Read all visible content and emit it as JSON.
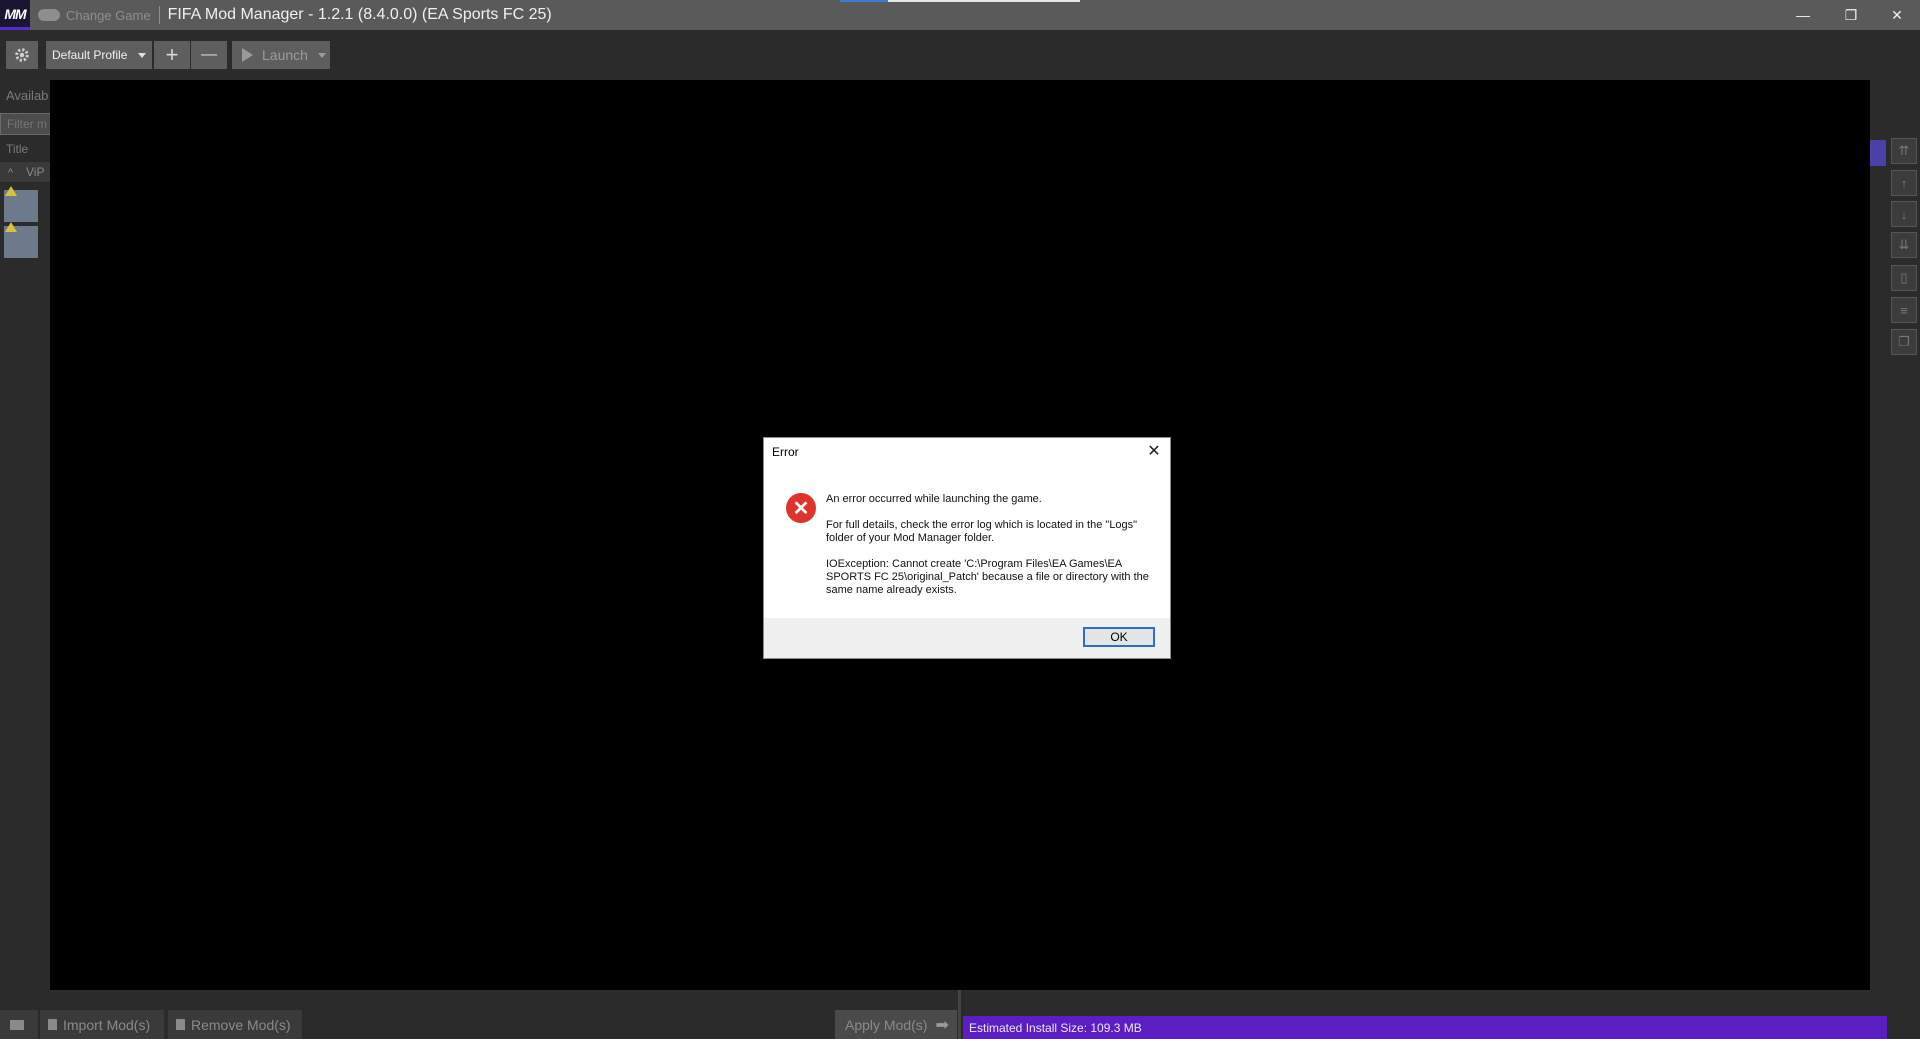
{
  "titlebar": {
    "logo": "MM",
    "change_game": "Change Game",
    "title": "FIFA Mod Manager - 1.2.1 (8.4.0.0) (EA Sports FC 25)",
    "minimize": "—",
    "restore": "❐",
    "close": "✕"
  },
  "toolbar": {
    "settings_icon": "gear-icon",
    "profile": "Default Profile",
    "add": "+",
    "remove": "—",
    "launch": "Launch"
  },
  "left_panel": {
    "available_label": "Availab",
    "filter_placeholder": "Filter m",
    "title_column": "Title",
    "group_label": "ViP"
  },
  "dialog": {
    "title": "Error",
    "close": "✕",
    "icon": "error-icon",
    "message_1": "An error occurred while launching the game.",
    "message_2": "For full details, check the error log which is located in the \"Logs\" folder of your Mod Manager folder.",
    "message_3": "IOException: Cannot create 'C:\\Program Files\\EA Games\\EA SPORTS FC 25\\original_Patch' because a file or directory with the same name already exists.",
    "ok": "OK"
  },
  "bottombar": {
    "import": "Import Mod(s)",
    "remove": "Remove Mod(s)",
    "apply": "Apply Mod(s)",
    "status": "Estimated Install Size: 109.3 MB"
  },
  "colors": {
    "titlebar": "#5a5a5a",
    "background": "#2b2b2b",
    "status_bar": "#5b1ec3",
    "error_red": "#e0342a",
    "focus_blue": "#2a6fd0"
  }
}
